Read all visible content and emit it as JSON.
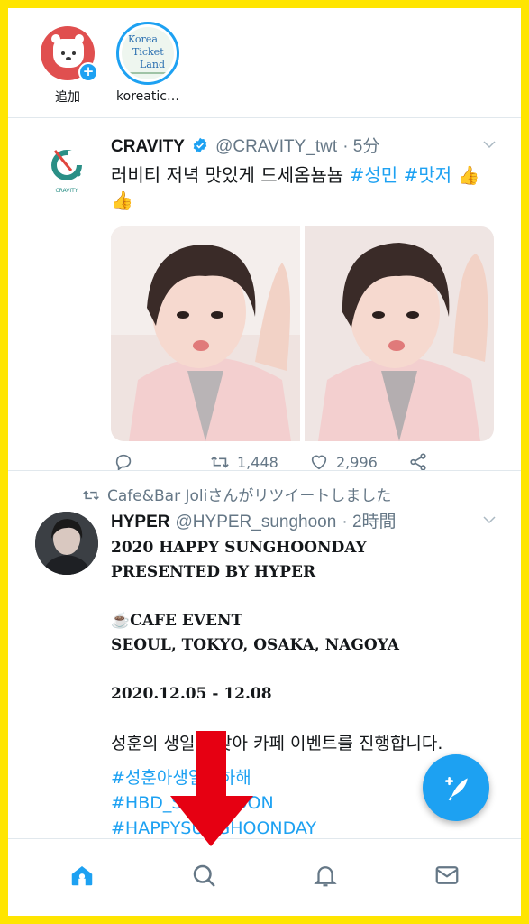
{
  "stories": [
    {
      "label": "追加",
      "icon": "bear-add-icon"
    },
    {
      "label": "koreatic…",
      "logo_lines": [
        "Korea",
        "Ticket",
        "Land"
      ]
    }
  ],
  "tweets": [
    {
      "name": "CRAVITY",
      "handle": "@CRAVITY_twt",
      "time": "· 5分",
      "text": "러비티 저녁 맛있게 드세옴뇸뇸",
      "hashtags": [
        "#성민",
        "#맛저"
      ],
      "emoji": "👍👍",
      "avatar_text": "CRAVITY",
      "replies_icon": "reply-icon",
      "retweets": "1,448",
      "likes": "2,996"
    },
    {
      "retweeted_by": "Cafe&Bar Joliさんがリツイートしました",
      "name": "HYPER",
      "handle": "@HYPER_sunghoon",
      "time": "· 2時間",
      "lines": [
        "2020 HAPPY SUNGHOONDAY",
        "PRESENTED BY HYPER",
        "",
        "☕CAFE EVENT",
        "SEOUL, TOKYO, OSAKA, NAGOYA",
        "",
        "2020.12.05 - 12.08",
        ""
      ],
      "korean_line": "성훈의 생일을 맞아 카페 이벤트를 진행합니다.",
      "hashtags": [
        "#성훈아생일축하해",
        "#HBD_SUNGHOON",
        "#HAPPYSUNGHOONDAY"
      ]
    }
  ],
  "colors": {
    "accent": "#1da1f2",
    "frame": "#ffe500",
    "arrow": "#e60012"
  },
  "nav": [
    "home-icon",
    "search-icon",
    "bell-icon",
    "mail-icon"
  ]
}
